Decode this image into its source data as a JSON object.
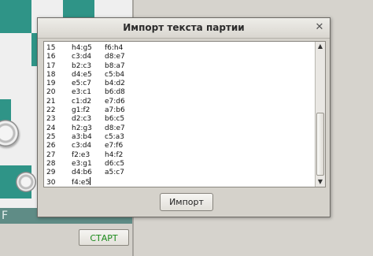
{
  "background": {
    "board_file_letter": "F",
    "start_button_label": "СТАРТ",
    "colors": {
      "board_dark": "#2f9487",
      "board_light": "#efefef",
      "start_text": "#1b8a1b"
    }
  },
  "dialog": {
    "title": "Импорт текста партии",
    "close_icon": "close-icon",
    "import_button_label": "Импорт",
    "moves": [
      {
        "num": "15",
        "white": "h4:g5",
        "black": "f6:h4"
      },
      {
        "num": "16",
        "white": "c3:d4",
        "black": "d8:e7"
      },
      {
        "num": "17",
        "white": "b2:c3",
        "black": "b8:a7"
      },
      {
        "num": "18",
        "white": "d4:e5",
        "black": "c5:b4"
      },
      {
        "num": "19",
        "white": "e5:c7",
        "black": "b4:d2"
      },
      {
        "num": "20",
        "white": "e3:c1",
        "black": "b6:d8"
      },
      {
        "num": "21",
        "white": "c1:d2",
        "black": "e7:d6"
      },
      {
        "num": "22",
        "white": "g1:f2",
        "black": "a7:b6"
      },
      {
        "num": "23",
        "white": "d2:c3",
        "black": "b6:c5"
      },
      {
        "num": "24",
        "white": "h2:g3",
        "black": "d8:e7"
      },
      {
        "num": "25",
        "white": "a3:b4",
        "black": "c5:a3"
      },
      {
        "num": "26",
        "white": "c3:d4",
        "black": "e7:f6"
      },
      {
        "num": "27",
        "white": "f2:e3",
        "black": "h4:f2"
      },
      {
        "num": "28",
        "white": "e3:g1",
        "black": "d6:c5"
      },
      {
        "num": "29",
        "white": "d4:b6",
        "black": "a5:c7"
      },
      {
        "num": "30",
        "white": "f4:e5",
        "black": ""
      }
    ]
  }
}
